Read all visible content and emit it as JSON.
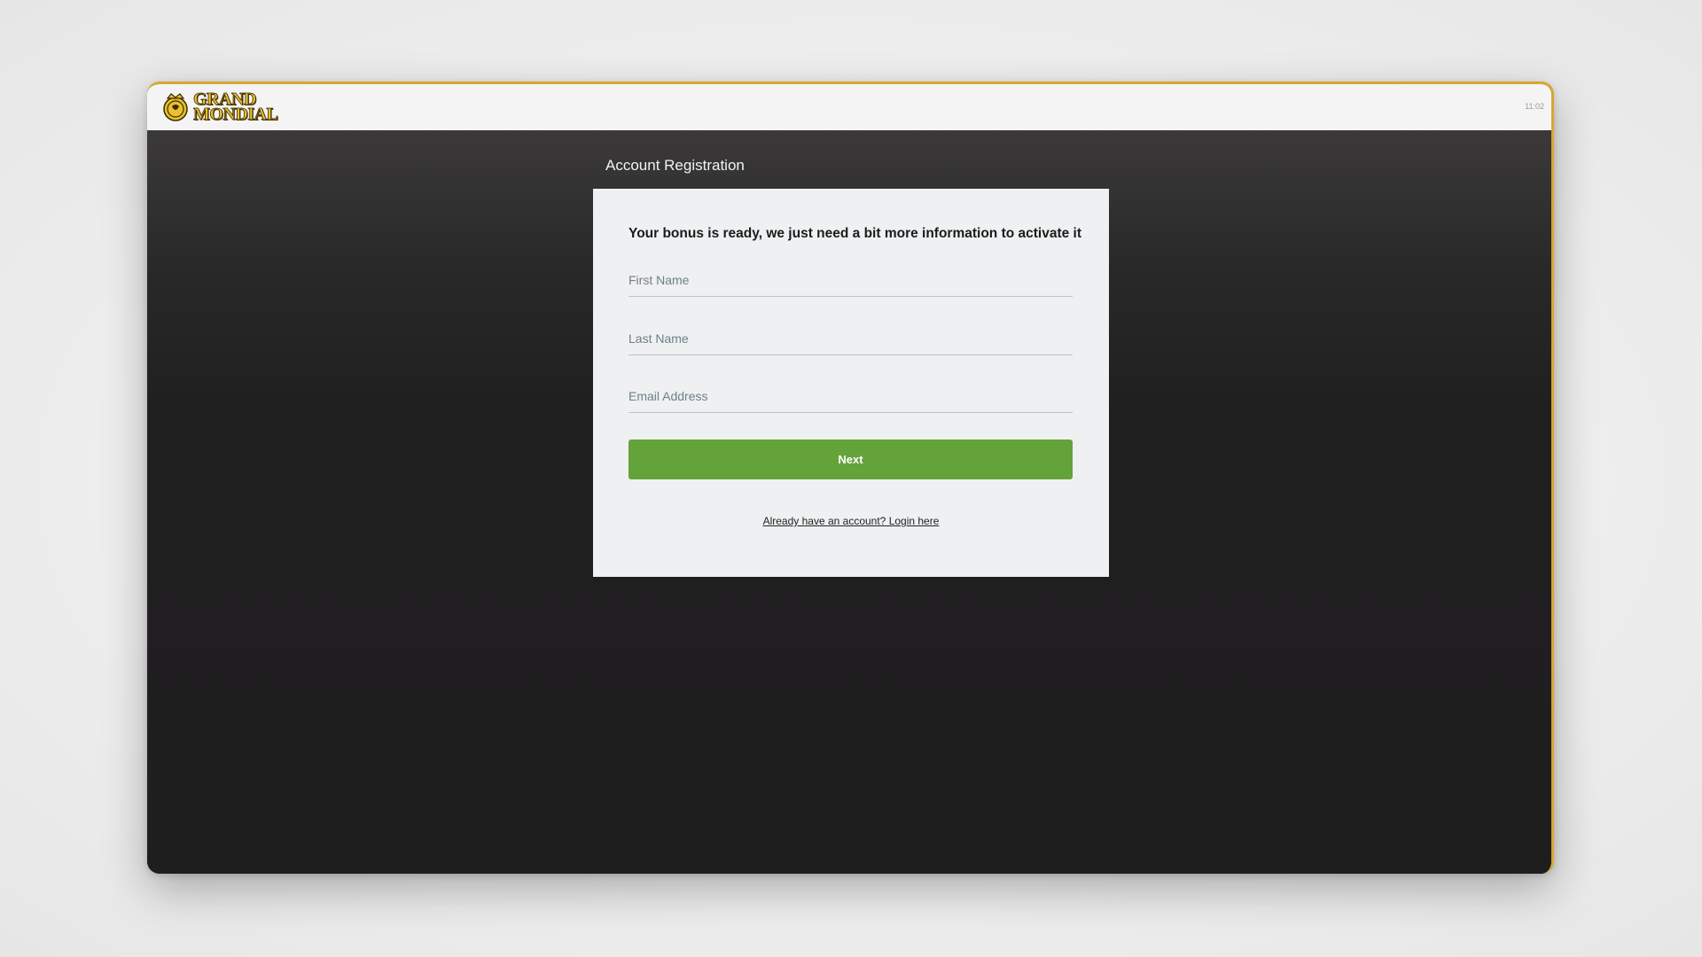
{
  "header": {
    "logo": {
      "line1": "GRAND",
      "line2": "MONDIAL",
      "emblem_icon": "crown-emblem-icon",
      "brand_color": "#e9c02f"
    },
    "clock": "11:02"
  },
  "main": {
    "title": "Account Registration",
    "card": {
      "heading": "Your bonus is ready, we just need a bit more information to activate it",
      "fields": {
        "first_name": {
          "placeholder": "First Name",
          "value": ""
        },
        "last_name": {
          "placeholder": "Last Name",
          "value": ""
        },
        "email": {
          "placeholder": "Email Address",
          "value": ""
        }
      },
      "next_label": "Next",
      "login_link": "Already have an account? Login here"
    }
  },
  "colors": {
    "accent_gold": "#d9a72e",
    "button_green": "#63a33a",
    "background_dark": "#1f1e1f"
  }
}
